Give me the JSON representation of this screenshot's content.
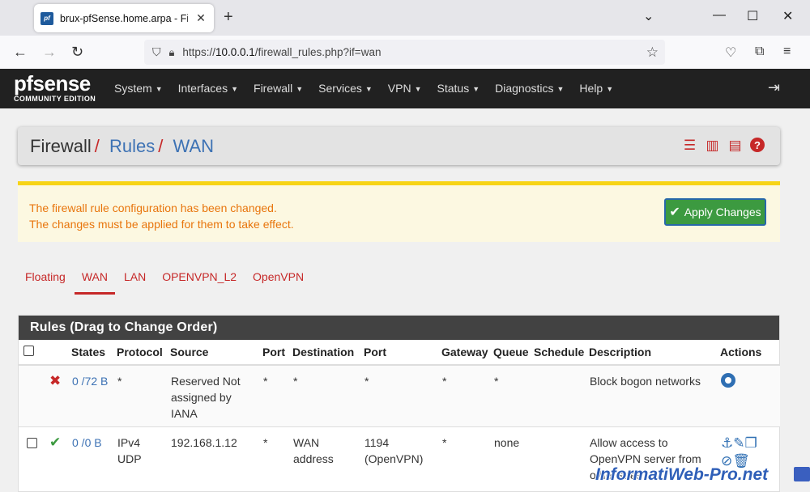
{
  "browser": {
    "tab_title": "brux-pfSense.home.arpa - Firew",
    "url_prefix": "https://",
    "url_host": "10.0.0.1",
    "url_path": "/firewall_rules.php?if=wan"
  },
  "pfsense": {
    "logo_brand": "pfsense",
    "logo_edition": "COMMUNITY EDITION",
    "menu": [
      "System",
      "Interfaces",
      "Firewall",
      "Services",
      "VPN",
      "Status",
      "Diagnostics",
      "Help"
    ]
  },
  "breadcrumb": {
    "part1": "Firewall",
    "part2": "Rules",
    "part3": "WAN"
  },
  "alert": {
    "line1": "The firewall rule configuration has been changed.",
    "line2": "The changes must be applied for them to take effect.",
    "button": "Apply Changes"
  },
  "tabs": [
    "Floating",
    "WAN",
    "LAN",
    "OPENVPN_L2",
    "OpenVPN"
  ],
  "active_tab": "WAN",
  "panel": {
    "title": "Rules (Drag to Change Order)",
    "headers": {
      "states": "States",
      "protocol": "Protocol",
      "source": "Source",
      "port": "Port",
      "destination": "Destination",
      "dport": "Port",
      "gateway": "Gateway",
      "queue": "Queue",
      "schedule": "Schedule",
      "description": "Description",
      "actions": "Actions"
    },
    "rows": [
      {
        "states": "0 /72 B",
        "protocol": "*",
        "source": "Reserved Not assigned by IANA",
        "port": "*",
        "destination": "*",
        "dport": "*",
        "gateway": "*",
        "queue": "*",
        "schedule": "",
        "description": "Block bogon networks"
      },
      {
        "states": "0 /0 B",
        "protocol": "IPv4 UDP",
        "source": "192.168.1.12",
        "port": "*",
        "destination": "WAN address",
        "dport": "1194 (OpenVPN)",
        "gateway": "*",
        "queue": "none",
        "schedule": "",
        "description": "Allow access to OpenVPN server from other sites"
      }
    ]
  },
  "watermark": "InformatiWeb-Pro.net",
  "colors": {
    "accent_red": "#c62828",
    "link_blue": "#3d72b4",
    "header_dark": "#212121",
    "alert_bg": "#fcf8e1",
    "alert_text": "#e8750c",
    "apply_green": "#3c9a40"
  }
}
